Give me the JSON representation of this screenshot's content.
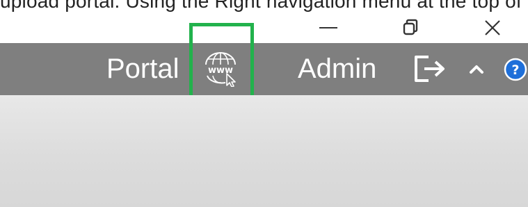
{
  "top_strip": {
    "text": "upload portal. Using the Right navigation menu at the top of"
  },
  "window_controls": {
    "minimize_icon": "minimize-icon",
    "restore_icon": "restore-icon",
    "close_icon": "close-icon"
  },
  "app_bar": {
    "portal_label": "Portal",
    "www_icon": "www-globe-cursor-icon",
    "admin_label": "Admin",
    "logout_icon": "logout-arrow-icon",
    "chevron_icon": "chevron-up-icon",
    "help_icon": "help-icon"
  },
  "colors": {
    "app_bar": "#7f7f7f",
    "highlight": "#22b24c",
    "help_blue": "#1e6fd9",
    "content_bg": "#dcdcdc"
  }
}
